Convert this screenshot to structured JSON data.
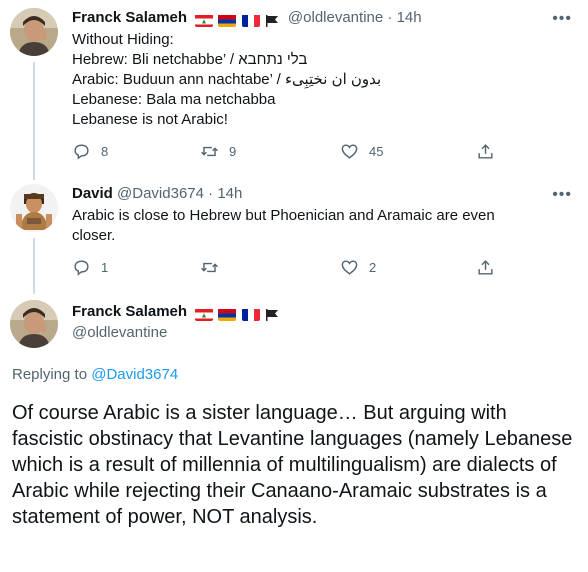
{
  "tweets": [
    {
      "name": "Franck Salameh",
      "handle": "@oldlevantine",
      "dot": "·",
      "time": "14h",
      "lines": [
        "Without Hiding:",
        "Hebrew: Bli netchabbe’ / בלי נתחבא",
        "Arabic: Buduun ann nachtabe’ / بدون ان نختِبِىء",
        "Lebanese: Bala ma netchabba",
        "Lebanese is not Arabic!"
      ],
      "replies": "8",
      "retweets": "9",
      "likes": "45"
    },
    {
      "name": "David",
      "handle": "@David3674",
      "dot": "·",
      "time": "14h",
      "lines": [
        "Arabic is close to Hebrew but Phoenician and Aramaic are even",
        "closer."
      ],
      "replies": "1",
      "retweets": "",
      "likes": "2"
    }
  ],
  "main_tweet": {
    "name": "Franck Salameh",
    "handle": "@oldlevantine",
    "replying_prefix": "Replying to",
    "replying_to": "@David3674",
    "text": "Of course Arabic is a sister language… But arguing with fascistic obstinacy that Levantine languages (namely Lebanese which is a result of millennia of multilingualism) are dialects of Arabic while rejecting their Canaano-Aramaic substrates is a statement of power, NOT analysis."
  },
  "more_label": "•••",
  "colors": {
    "text": "#0f1419",
    "secondary": "#536471",
    "link": "#1d9bf0",
    "thread_line": "#cfd9de"
  },
  "icons": [
    "reply-icon",
    "retweet-icon",
    "like-icon",
    "share-icon",
    "more-icon",
    "flag-lebanon",
    "flag-armenia",
    "flag-france",
    "flag-black"
  ]
}
